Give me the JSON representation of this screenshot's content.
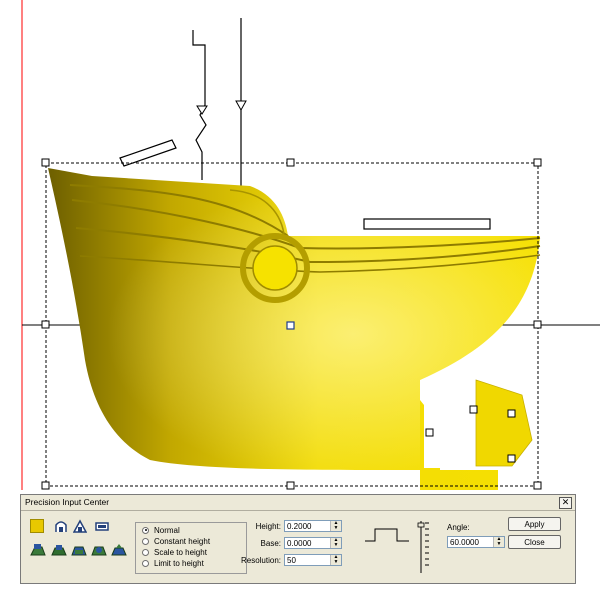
{
  "panel": {
    "title": "Precision Input Center",
    "close_glyph": "✕",
    "modes": [
      {
        "label": "Normal",
        "selected": true
      },
      {
        "label": "Constant height",
        "selected": false
      },
      {
        "label": "Scale to height",
        "selected": false
      },
      {
        "label": "Limit to height",
        "selected": false
      }
    ],
    "fields": {
      "height": {
        "label": "Height:",
        "value": "0.2000"
      },
      "base": {
        "label": "Base:",
        "value": "0.0000"
      },
      "resolution": {
        "label": "Resolution:",
        "value": "50"
      },
      "angle": {
        "label": "Angle:",
        "value": "60.0000"
      }
    },
    "buttons": {
      "apply": "Apply",
      "close": "Close"
    }
  },
  "colors": {
    "hull": "#f0d800",
    "hull_dark": "#7a6a00",
    "selection": "#000000",
    "handle_center": "#1f3c8c",
    "guide": "#ff0000",
    "swatch": "#e8c800"
  },
  "icons": [
    "color-swatch-icon",
    "profile-arch-icon",
    "profile-peak-icon",
    "profile-flat-icon",
    "relief-tool-icon"
  ]
}
